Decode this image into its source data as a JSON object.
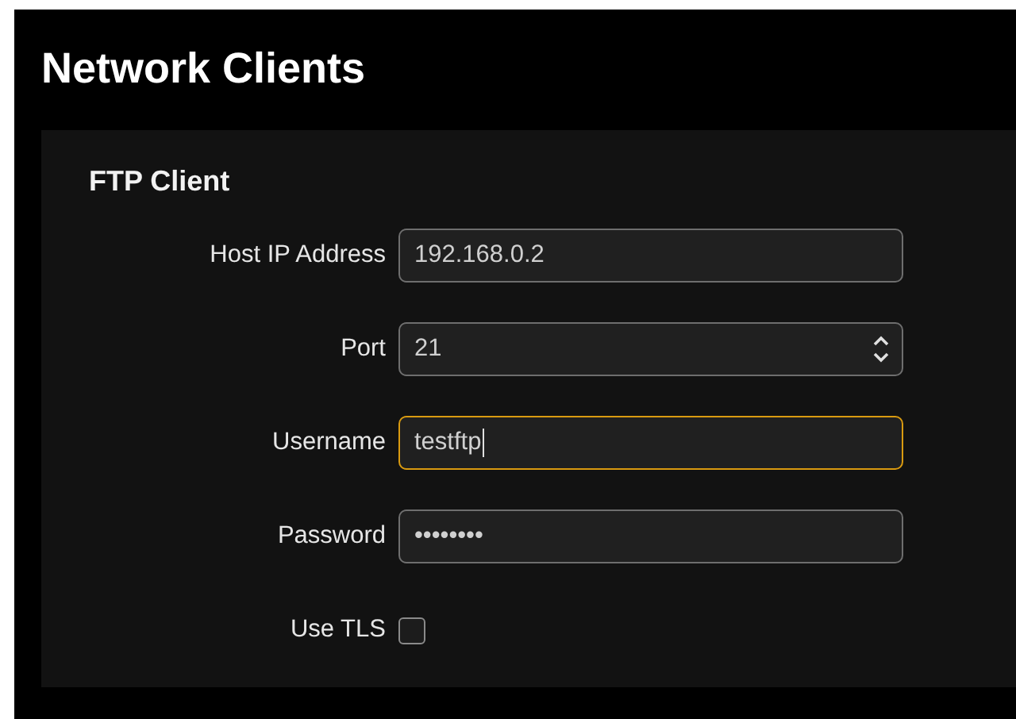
{
  "page": {
    "title": "Network Clients"
  },
  "section": {
    "title": "FTP Client",
    "fields": [
      {
        "kind": "text",
        "label": "Host IP Address",
        "value": "192.168.0.2",
        "focused": false
      },
      {
        "kind": "spinner",
        "label": "Port",
        "value": "21",
        "focused": false
      },
      {
        "kind": "text",
        "label": "Username",
        "value": "testftp",
        "focused": true
      },
      {
        "kind": "text",
        "label": "Password",
        "value": "••••••••",
        "focused": false
      },
      {
        "kind": "checkbox",
        "label": "Use TLS",
        "checked": false
      }
    ]
  }
}
